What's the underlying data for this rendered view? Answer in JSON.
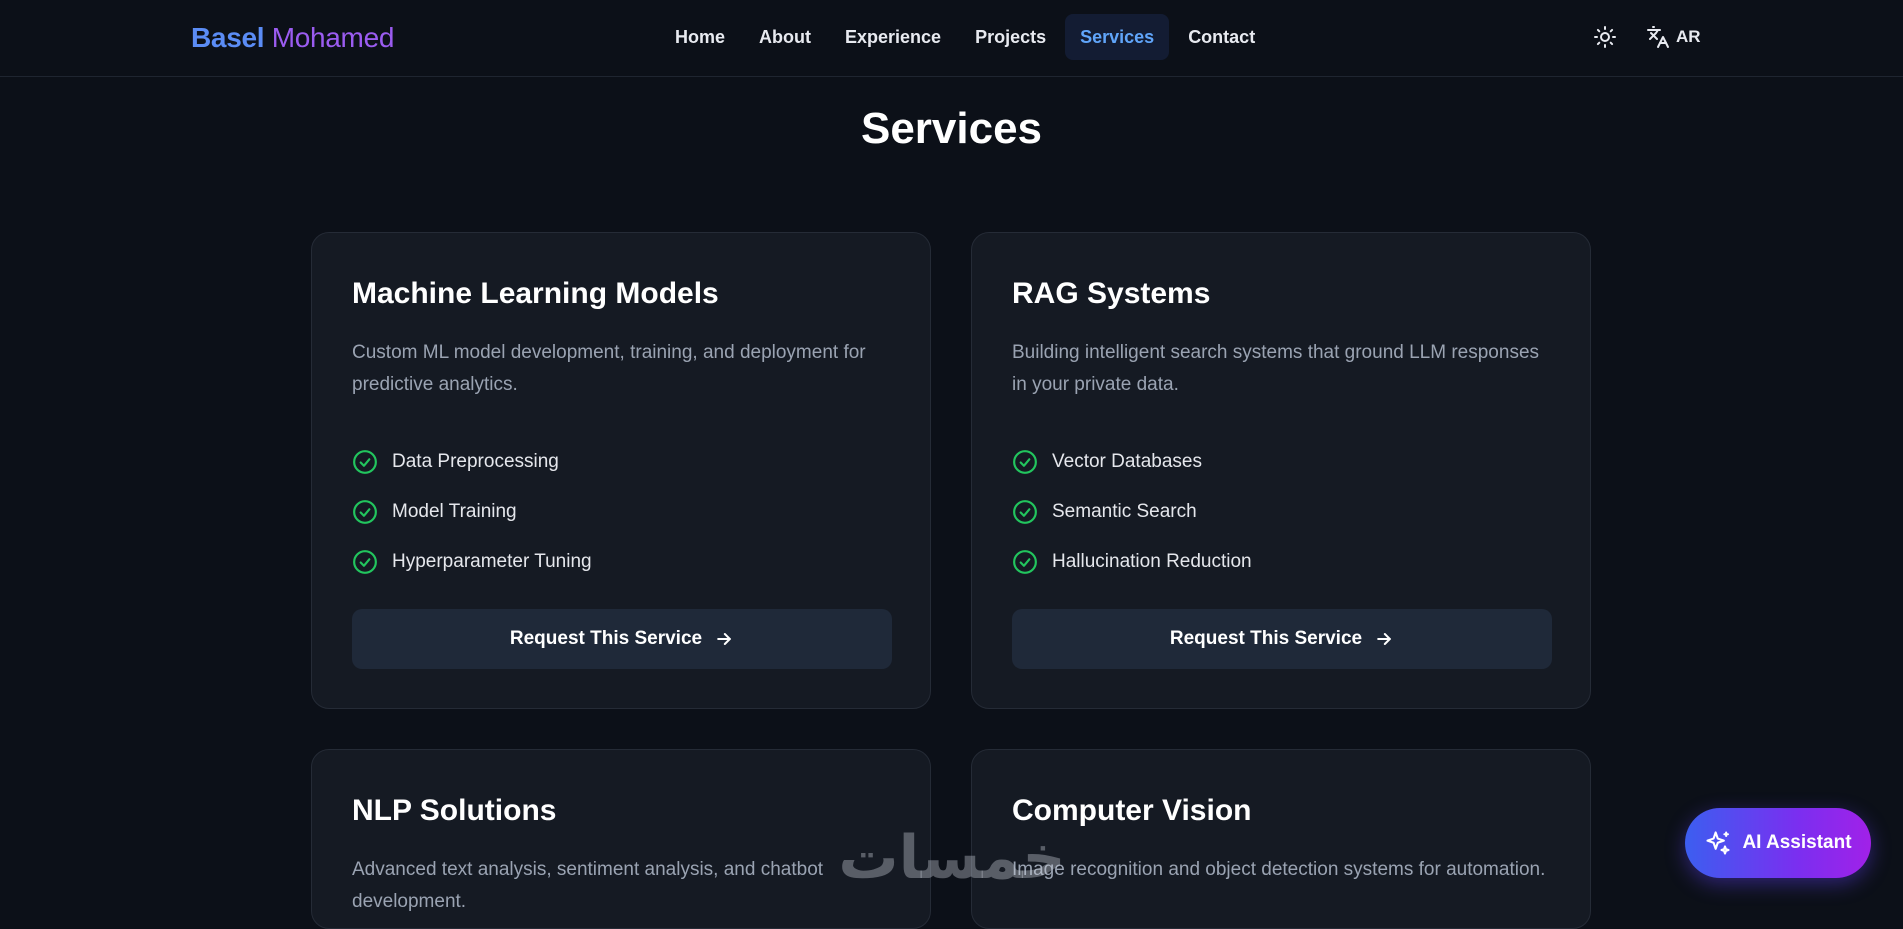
{
  "brand": {
    "first": "Basel",
    "last": "Mohamed"
  },
  "nav": {
    "items": [
      {
        "label": "Home",
        "active": false
      },
      {
        "label": "About",
        "active": false
      },
      {
        "label": "Experience",
        "active": false
      },
      {
        "label": "Projects",
        "active": false
      },
      {
        "label": "Services",
        "active": true
      },
      {
        "label": "Contact",
        "active": false
      }
    ],
    "theme_icon": "sun-icon",
    "lang_icon": "translate-icon",
    "lang_label": "AR"
  },
  "page": {
    "title": "Services"
  },
  "services": [
    {
      "title": "Machine Learning Models",
      "description": "Custom ML model development, training, and deployment for predictive analytics.",
      "features": [
        "Data Preprocessing",
        "Model Training",
        "Hyperparameter Tuning"
      ],
      "cta": "Request This Service"
    },
    {
      "title": "RAG Systems",
      "description": "Building intelligent search systems that ground LLM responses in your private data.",
      "features": [
        "Vector Databases",
        "Semantic Search",
        "Hallucination Reduction"
      ],
      "cta": "Request This Service"
    },
    {
      "title": "NLP Solutions",
      "description": "Advanced text analysis, sentiment analysis, and chatbot development."
    },
    {
      "title": "Computer Vision",
      "description": "Image recognition and object detection systems for automation."
    }
  ],
  "assistant": {
    "label": "AI Assistant",
    "icon": "sparkles-icon"
  },
  "watermark": {
    "text": "خمسات"
  },
  "colors": {
    "background": "#0c1018",
    "card": "#151a23",
    "accent_blue": "#60a5fa",
    "check_green": "#22c55e",
    "brand_blue": "#5b8cf5",
    "brand_purple": "#9b5cf0"
  }
}
